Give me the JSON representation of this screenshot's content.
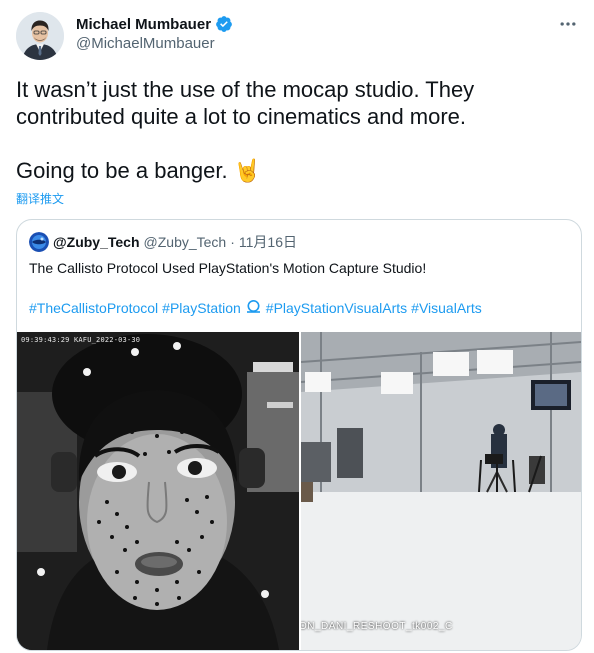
{
  "author": {
    "name": "Michael Mumbauer",
    "handle": "@MichaelMumbauer",
    "avatar_icon": "person-avatar-icon",
    "verified_icon": "verified-badge-icon",
    "verified_color": "#1d9bf0"
  },
  "tweet": {
    "line1": "It wasn’t just the use of the mocap studio. They",
    "line2": "contributed quite a lot to cinematics and more.",
    "line3": "Going to be a banger. 🤘",
    "translate_label": "翻译推文"
  },
  "quoted": {
    "name": "@Zuby_Tech",
    "handle": "@Zuby_Tech",
    "separator": "·",
    "date": "11月16日",
    "text": "The Callisto Protocol Used PlayStation's Motion Capture Studio!",
    "hashtags": {
      "tag1": "#TheCallistoProtocol",
      "tag2": "#PlayStation",
      "tag3": "#PlayStationVisualArts",
      "tag4": "#VisualArts"
    },
    "media": {
      "left_timecode": "09:39:43:29 KAFU_2022-03-30",
      "right_caption": "ON_DANI_RESHOOT_tk002_C"
    }
  },
  "colors": {
    "text_primary": "#0f1419",
    "text_secondary": "#536471",
    "link_blue": "#1d9bf0",
    "border": "#cfd9de"
  }
}
